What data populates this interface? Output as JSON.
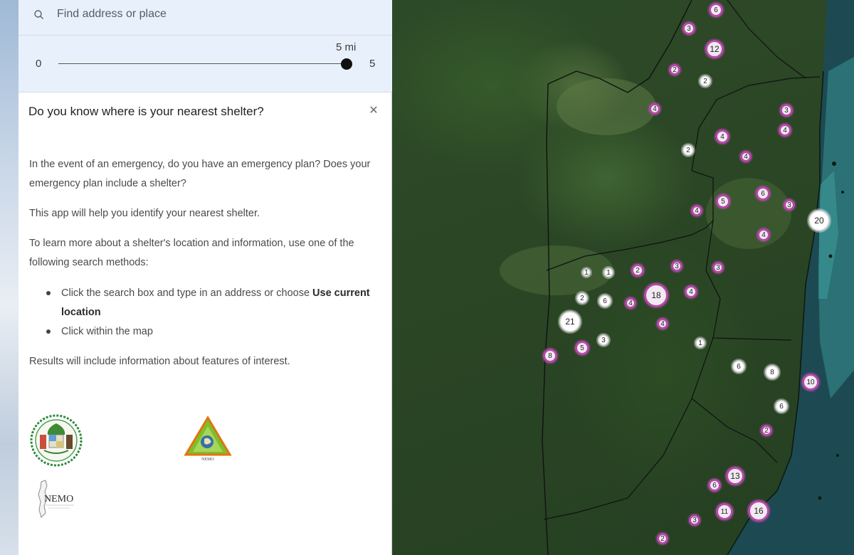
{
  "search": {
    "placeholder": "Find address or place",
    "icon": "search-icon"
  },
  "slider": {
    "min": "0",
    "max": "5",
    "value_label": "5 mi",
    "value": 5
  },
  "card": {
    "title": "Do you know where is your nearest shelter?",
    "close_icon": "close-icon",
    "para1": "In the event of an emergency, do you have an emergency plan? Does your emergency plan include a shelter?",
    "para2": "This app will help you identify your nearest shelter.",
    "para3": "To learn more about a shelter's location and information, use one of the following search methods:",
    "bullet1_text": "Click the search box and type in an address or choose ",
    "bullet1_bold": "Use current location",
    "bullet2": "Click within the map",
    "para4": "Results will include information about features of interest."
  },
  "logos": {
    "nemo_text": "NEMO",
    "triangle_text": "NEMO"
  },
  "colors": {
    "panel_header_bg": "#e8f1fb",
    "cluster_pink": "#b548a9",
    "cluster_white": "#ffffff"
  },
  "map": {
    "clusters": [
      {
        "label": "6",
        "style": "pink"
      },
      {
        "label": "3",
        "style": "pink"
      },
      {
        "label": "12",
        "style": "pink"
      },
      {
        "label": "2",
        "style": "pink"
      },
      {
        "label": "2",
        "style": "white"
      },
      {
        "label": "4",
        "style": "pink"
      },
      {
        "label": "3",
        "style": "pink"
      },
      {
        "label": "4",
        "style": "pink"
      },
      {
        "label": "4",
        "style": "pink"
      },
      {
        "label": "4",
        "style": "pink"
      },
      {
        "label": "2",
        "style": "white"
      },
      {
        "label": "5",
        "style": "pink"
      },
      {
        "label": "6",
        "style": "pink"
      },
      {
        "label": "3",
        "style": "pink"
      },
      {
        "label": "4",
        "style": "pink"
      },
      {
        "label": "20",
        "style": "white"
      },
      {
        "label": "4",
        "style": "pink"
      },
      {
        "label": "1",
        "style": "white"
      },
      {
        "label": "1",
        "style": "white"
      },
      {
        "label": "2",
        "style": "pink"
      },
      {
        "label": "3",
        "style": "pink"
      },
      {
        "label": "3",
        "style": "pink"
      },
      {
        "label": "2",
        "style": "white"
      },
      {
        "label": "6",
        "style": "white"
      },
      {
        "label": "4",
        "style": "pink"
      },
      {
        "label": "18",
        "style": "pink"
      },
      {
        "label": "4",
        "style": "pink"
      },
      {
        "label": "21",
        "style": "white"
      },
      {
        "label": "4",
        "style": "pink"
      },
      {
        "label": "3",
        "style": "white"
      },
      {
        "label": "5",
        "style": "pink"
      },
      {
        "label": "8",
        "style": "pink"
      },
      {
        "label": "1",
        "style": "white"
      },
      {
        "label": "6",
        "style": "white"
      },
      {
        "label": "8",
        "style": "white"
      },
      {
        "label": "10",
        "style": "pink"
      },
      {
        "label": "6",
        "style": "white"
      },
      {
        "label": "2",
        "style": "pink"
      },
      {
        "label": "13",
        "style": "pink"
      },
      {
        "label": "6",
        "style": "pink"
      },
      {
        "label": "11",
        "style": "pink"
      },
      {
        "label": "16",
        "style": "pink"
      },
      {
        "label": "3",
        "style": "pink"
      },
      {
        "label": "2",
        "style": "pink"
      },
      {
        "label": "3",
        "style": "white"
      }
    ]
  }
}
